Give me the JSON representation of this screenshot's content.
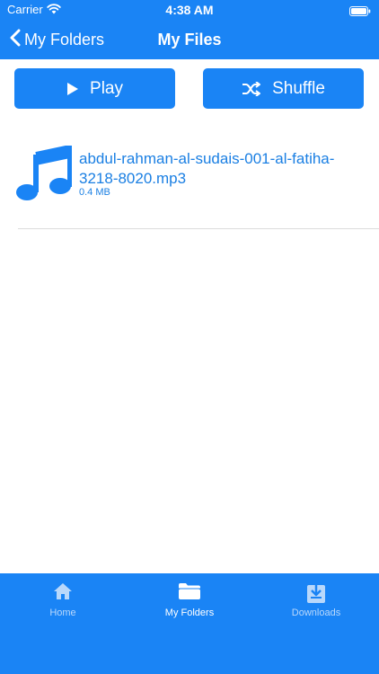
{
  "status": {
    "carrier": "Carrier",
    "time": "4:38 AM",
    "wifi_icon": "wifi-icon",
    "battery_icon": "battery-icon"
  },
  "nav": {
    "back_label": "My Folders",
    "title": "My Files"
  },
  "actions": {
    "play_label": "Play",
    "shuffle_label": "Shuffle"
  },
  "files": [
    {
      "icon": "music-note-icon",
      "name": "abdul-rahman-al-sudais-001-al-fatiha-3218-8020.mp3",
      "size": "0.4 MB"
    }
  ],
  "tabbar": {
    "tabs": [
      {
        "label": "Home",
        "icon": "house-icon",
        "active": false
      },
      {
        "label": "My Folders",
        "icon": "folder-icon",
        "active": true
      },
      {
        "label": "Downloads",
        "icon": "download-icon",
        "active": false
      }
    ]
  },
  "colors": {
    "accent": "#1a84f5",
    "link_text": "#1a7fe3",
    "tab_inactive": "#b9d8fb"
  }
}
